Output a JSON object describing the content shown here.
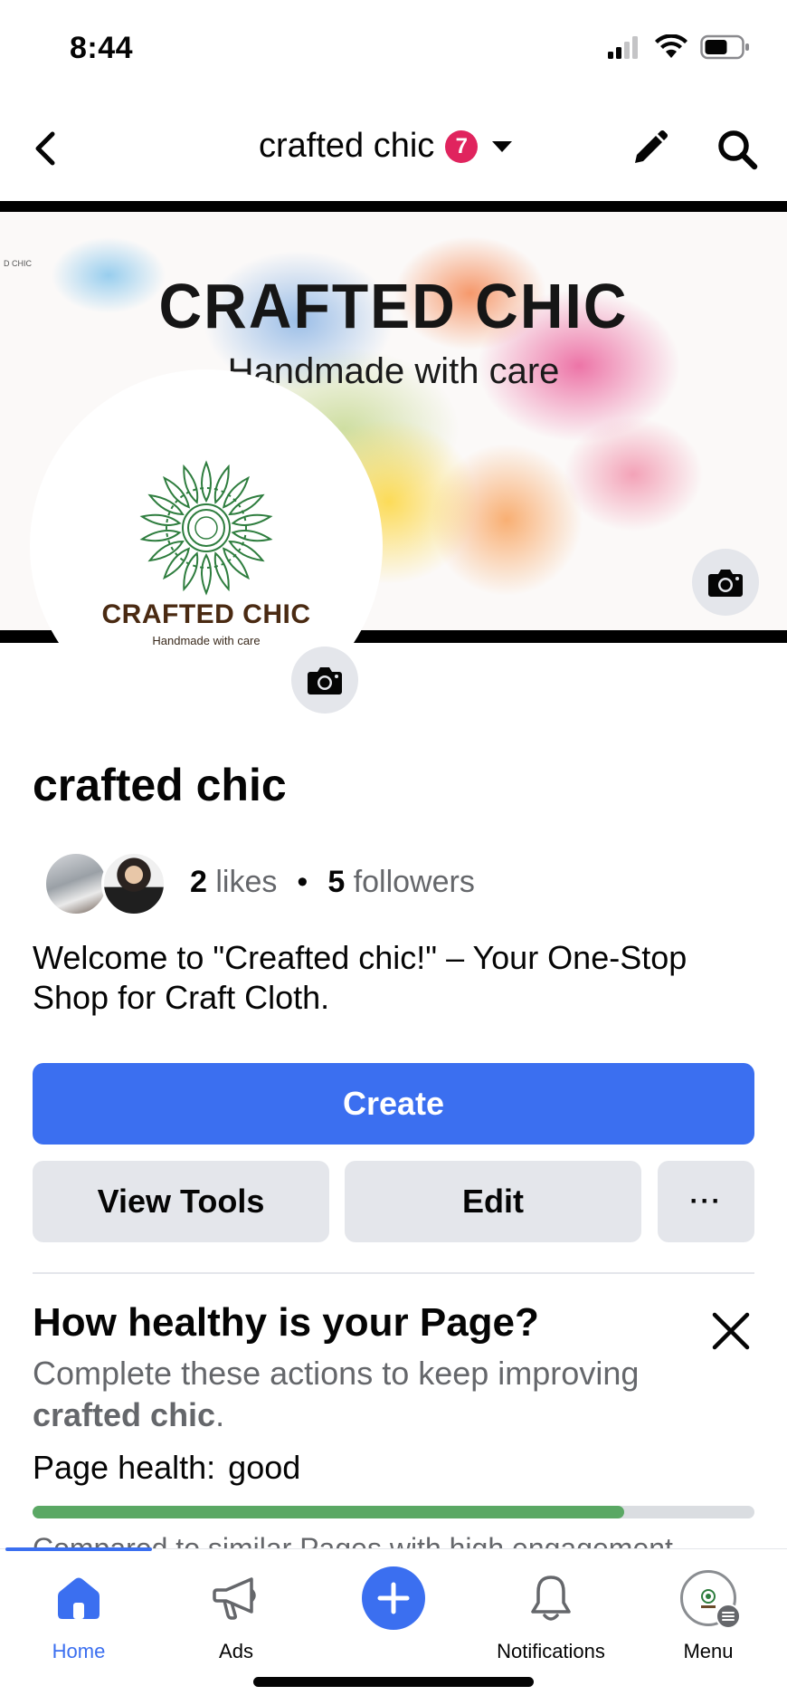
{
  "status_bar": {
    "time": "8:44"
  },
  "nav": {
    "title": "crafted chic",
    "badge_count": "7"
  },
  "cover": {
    "title": "CRAFTED CHIC",
    "subtitle": "Handmade with care",
    "corner_text": "D CHIC"
  },
  "profile_logo": {
    "name": "CRAFTED CHIC",
    "tagline": "Handmade with care"
  },
  "page": {
    "name": "crafted chic",
    "likes_count": "2",
    "likes_label": "likes",
    "followers_count": "5",
    "followers_label": "followers",
    "description": "Welcome to \"Creafted chic!\" – Your One-Stop Shop for Craft Cloth."
  },
  "actions": {
    "create_label": "Create",
    "view_tools_label": "View Tools",
    "edit_label": "Edit",
    "more_label": "···"
  },
  "health": {
    "title": "How healthy is your Page?",
    "subtitle_prefix": "Complete these actions to keep improving",
    "subtitle_page": "crafted chic",
    "subtitle_suffix": ".",
    "label": "Page health:",
    "value": "good",
    "progress_fraction": 0.82,
    "compare_text": "Compared to similar Pages with high engagement"
  },
  "tabbar": {
    "tabs": [
      {
        "id": "home",
        "label": "Home",
        "active": true
      },
      {
        "id": "ads",
        "label": "Ads",
        "active": false
      },
      {
        "id": "create",
        "label": "",
        "active": false
      },
      {
        "id": "notifications",
        "label": "Notifications",
        "active": false
      },
      {
        "id": "menu",
        "label": "Menu",
        "active": false
      }
    ]
  },
  "colors": {
    "accent": "#3b6ff0",
    "badge": "#e0245e",
    "progress": "#5aa864",
    "secondary_button": "#e4e6eb",
    "muted_text": "#65676b"
  },
  "icons": [
    "signal-icon",
    "wifi-icon",
    "battery-icon",
    "back-arrow-icon",
    "caret-down-icon",
    "pencil-icon",
    "search-icon",
    "camera-icon",
    "close-icon",
    "home-icon",
    "megaphone-icon",
    "plus-icon",
    "bell-icon",
    "menu-icon"
  ]
}
